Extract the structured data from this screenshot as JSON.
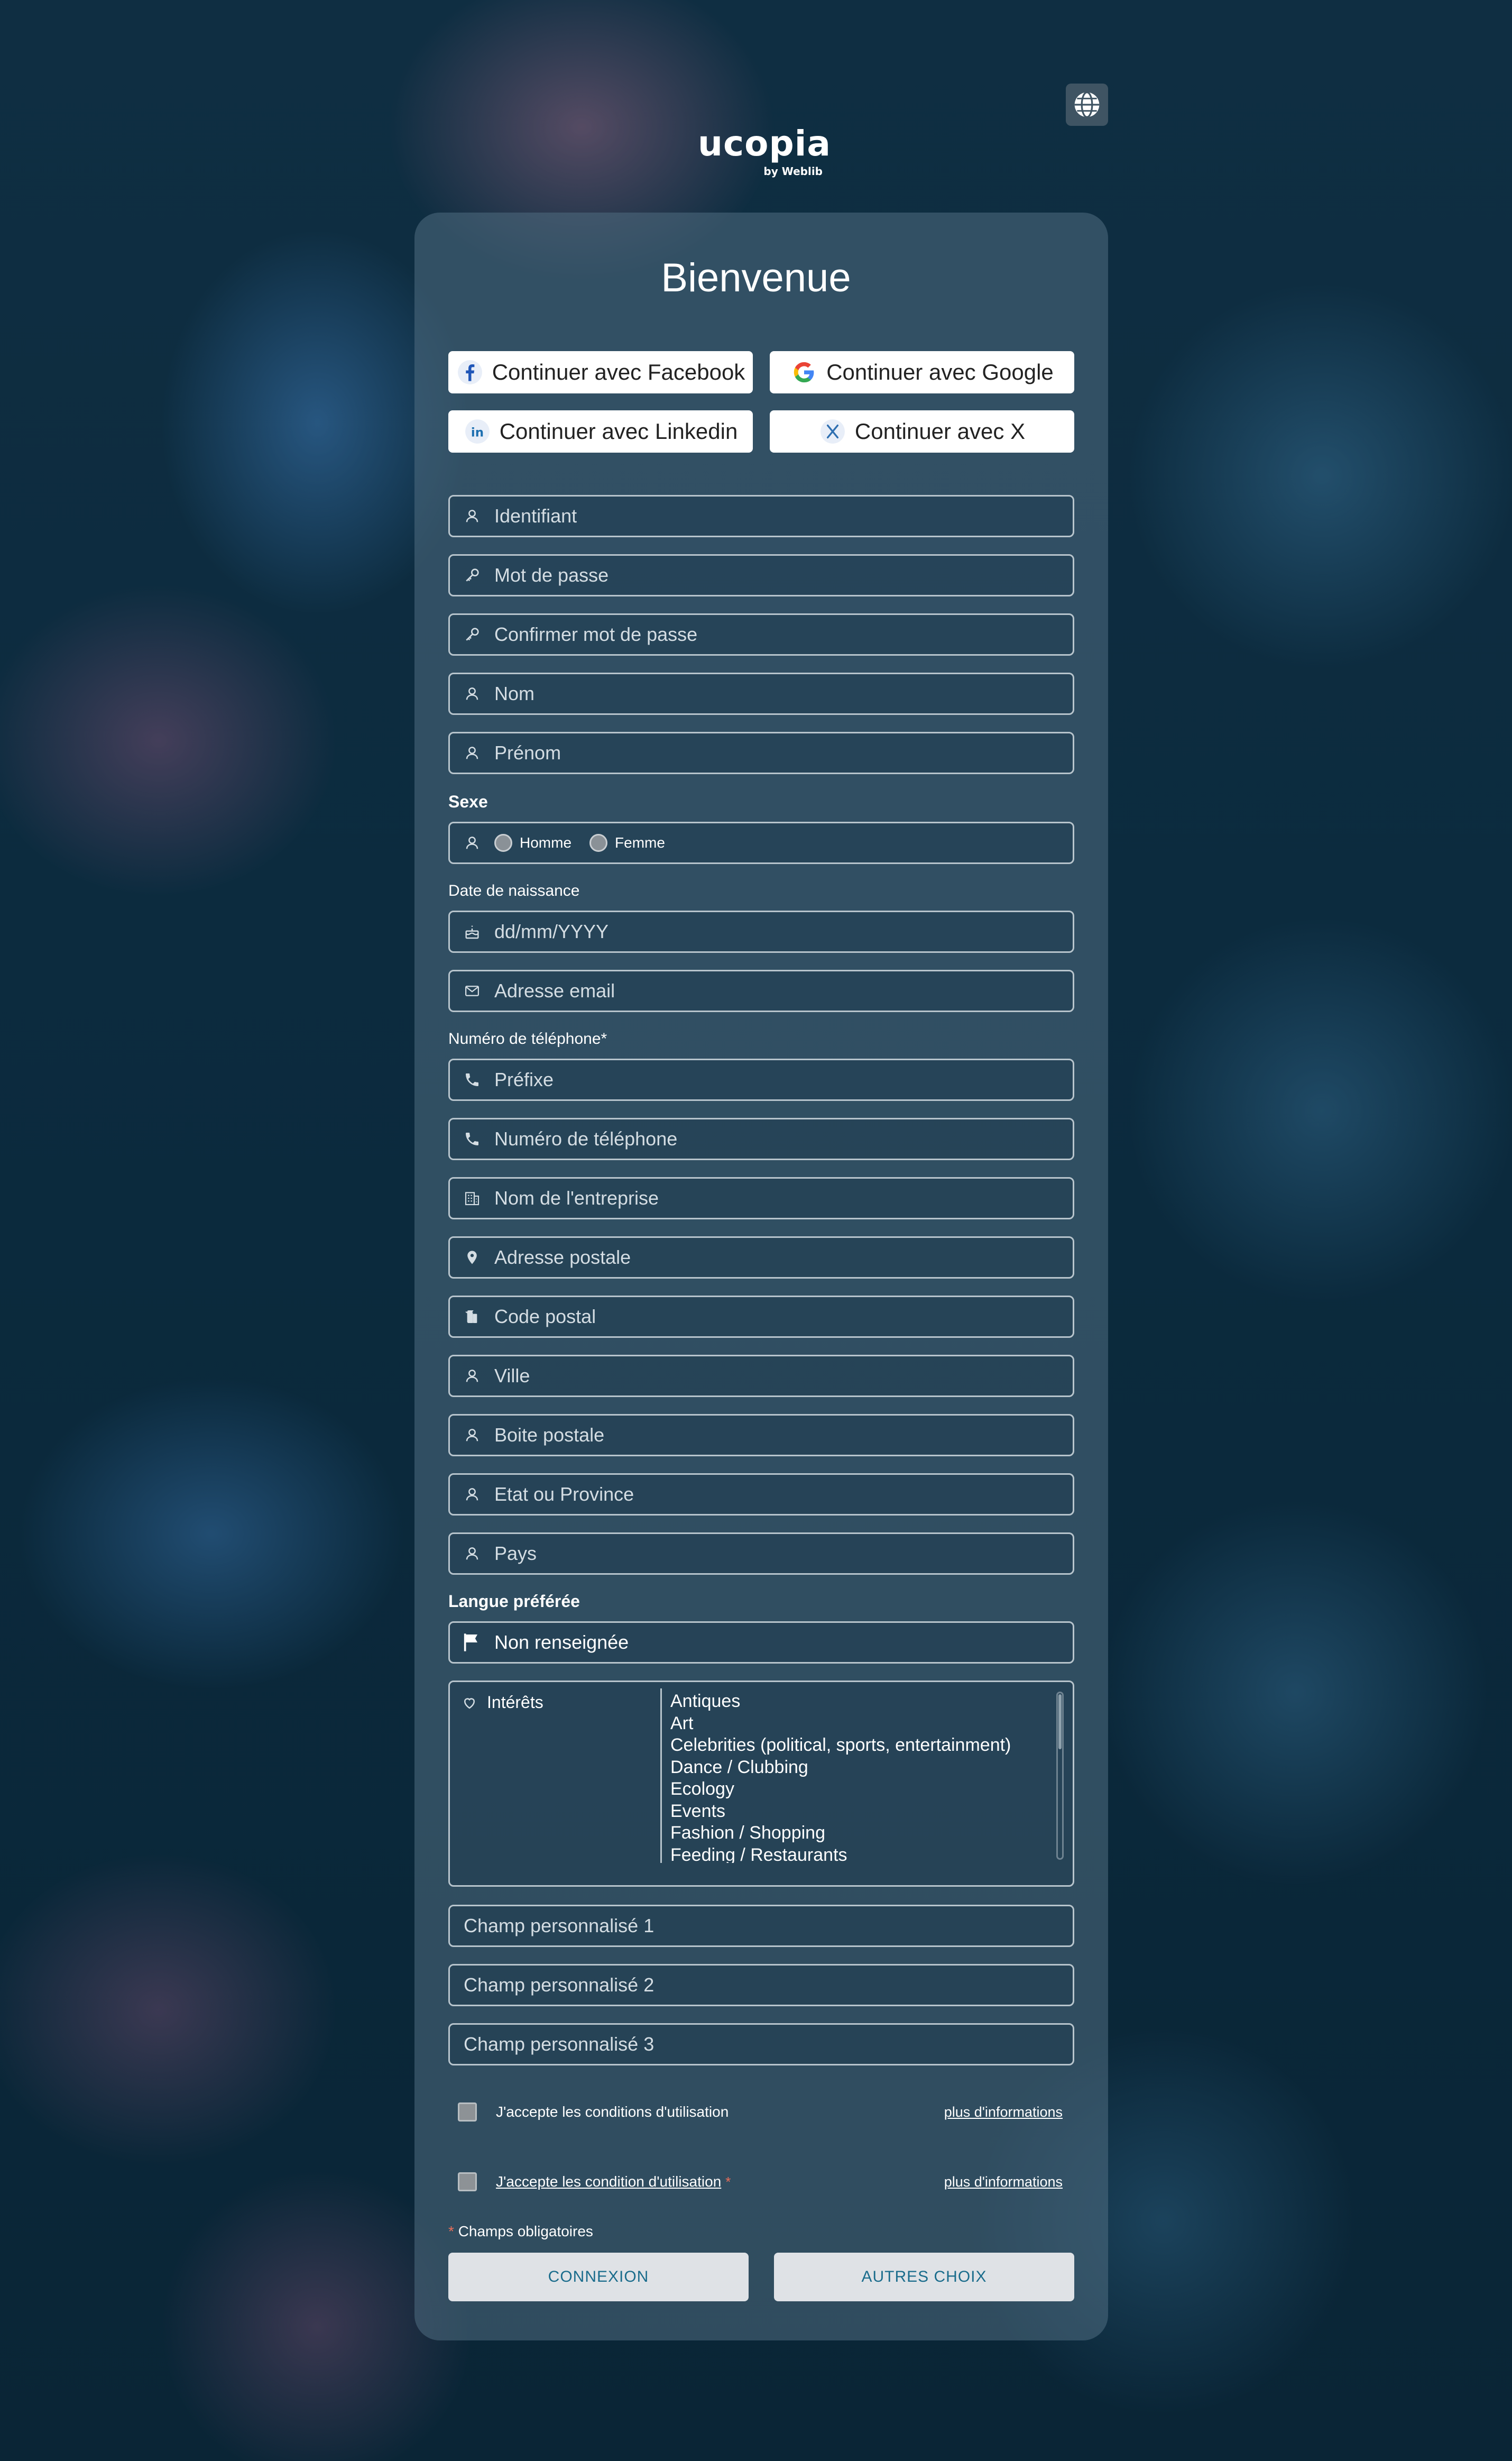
{
  "brand": {
    "name": "ucopia",
    "byline": "by Weblib"
  },
  "title": "Bienvenue",
  "social": {
    "facebook": "Continuer avec Facebook",
    "google": "Continuer avec Google",
    "linkedin": "Continuer avec Linkedin",
    "x": "Continuer avec X"
  },
  "fields": {
    "identifiant": "Identifiant",
    "password": "Mot de passe",
    "confirm_password": "Confirmer mot de passe",
    "nom": "Nom",
    "prenom": "Prénom",
    "sexe_label": "Sexe",
    "sexe_options": [
      "Homme",
      "Femme"
    ],
    "birth_label": "Date de naissance",
    "birth_placeholder": "dd/mm/YYYY",
    "email": "Adresse email",
    "phone_label": "Numéro de téléphone",
    "phone_required": "*",
    "prefix": "Préfixe",
    "phone": "Numéro de téléphone",
    "company": "Nom de l'entreprise",
    "address": "Adresse postale",
    "postal_code": "Code postal",
    "city": "Ville",
    "po_box": "Boite postale",
    "state": "Etat ou Province",
    "country": "Pays",
    "lang_label": "Langue préférée",
    "lang_value": "Non renseignée",
    "interests_label": "Intérêts",
    "interests_options": [
      "Antiques",
      "Art",
      "Celebrities (political, sports, entertainment)",
      "Dance / Clubbing",
      "Ecology",
      "Events",
      "Fashion / Shopping",
      "Feeding / Restaurants"
    ],
    "custom1": "Champ personnalisé 1",
    "custom2": "Champ personnalisé 2",
    "custom3": "Champ personnalisé 3"
  },
  "terms": {
    "accept1": "J'accepte les conditions d'utilisation",
    "accept2": "J'accepte les condition d'utilisation",
    "required_mark": "*",
    "more_info": "plus d'informations"
  },
  "footer": {
    "required_note_mark": "*",
    "required_note": "Champs obligatoires",
    "connect": "CONNEXION",
    "other": "AUTRES CHOIX"
  },
  "colors": {
    "background": "#0c2a3c",
    "card": "#4d6b7e",
    "button_text": "#1a6c8c",
    "required": "#e86e5a"
  }
}
